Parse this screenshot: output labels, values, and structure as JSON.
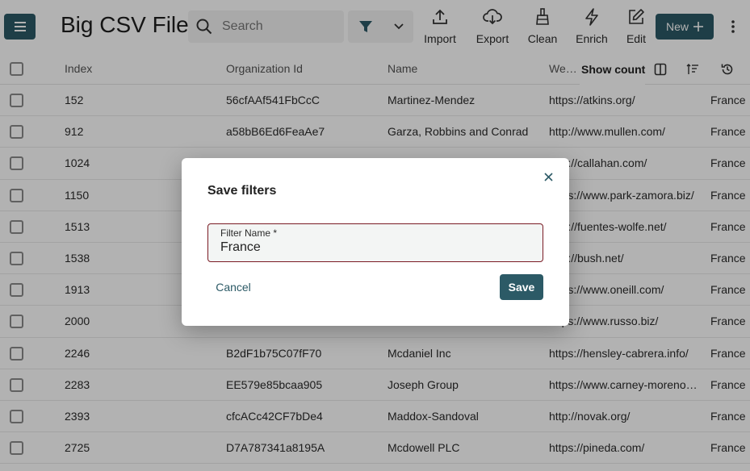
{
  "header": {
    "title": "Big CSV File",
    "search_placeholder": "Search",
    "tools": {
      "import": "Import",
      "export": "Export",
      "clean": "Clean",
      "enrich": "Enrich",
      "edit": "Edit"
    },
    "new_label": "New"
  },
  "table": {
    "columns": {
      "index": "Index",
      "org": "Organization Id",
      "name": "Name",
      "website": "Website",
      "show_count": "Show count"
    },
    "rows": [
      {
        "index": "152",
        "org": "56cfAAf541FbCcC",
        "name": "Martinez-Mendez",
        "website": "https://atkins.org/",
        "country": "France"
      },
      {
        "index": "912",
        "org": "a58bB6Ed6FeaAe7",
        "name": "Garza, Robbins and Conrad",
        "website": "http://www.mullen.com/",
        "country": "France"
      },
      {
        "index": "1024",
        "org": "",
        "name": "",
        "website": "http://callahan.com/",
        "country": "France"
      },
      {
        "index": "1150",
        "org": "",
        "name": "",
        "website": "https://www.park-zamora.biz/",
        "country": "France"
      },
      {
        "index": "1513",
        "org": "",
        "name": "",
        "website": "http://fuentes-wolfe.net/",
        "country": "France"
      },
      {
        "index": "1538",
        "org": "",
        "name": "",
        "website": "http://bush.net/",
        "country": "France"
      },
      {
        "index": "1913",
        "org": "",
        "name": "",
        "website": "https://www.oneill.com/",
        "country": "France"
      },
      {
        "index": "2000",
        "org": "",
        "name": "",
        "website": "https://www.russo.biz/",
        "country": "France"
      },
      {
        "index": "2246",
        "org": "B2dF1b75C07fF70",
        "name": "Mcdaniel Inc",
        "website": "https://hensley-cabrera.info/",
        "country": "France"
      },
      {
        "index": "2283",
        "org": "EE579e85bcaa905",
        "name": "Joseph Group",
        "website": "https://www.carney-moreno.com/",
        "country": "France"
      },
      {
        "index": "2393",
        "org": "cfcACc42CF7bDe4",
        "name": "Maddox-Sandoval",
        "website": "http://novak.org/",
        "country": "France"
      },
      {
        "index": "2725",
        "org": "D7A787341a8195A",
        "name": "Mcdowell PLC",
        "website": "https://pineda.com/",
        "country": "France"
      }
    ]
  },
  "dialog": {
    "title": "Save filters",
    "field_label": "Filter Name *",
    "field_value": "France",
    "cancel_label": "Cancel",
    "save_label": "Save"
  },
  "colors": {
    "primary": "#2c5a66",
    "field_border": "#7a1b24"
  }
}
